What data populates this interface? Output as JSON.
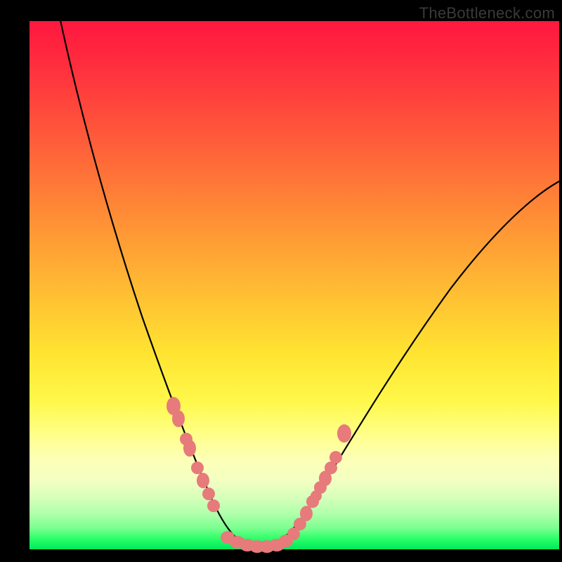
{
  "watermark": "TheBottleneck.com",
  "colors": {
    "background": "#000000",
    "gradient_top": "#ff173f",
    "gradient_bottom": "#00e85a",
    "curve": "#000000",
    "markers": "#e77a7b"
  },
  "chart_data": {
    "type": "line",
    "title": "",
    "xlabel": "",
    "ylabel": "",
    "ylim": [
      0,
      100
    ],
    "xlim": [
      0,
      100
    ],
    "series": [
      {
        "name": "bottleneck-curve",
        "x": [
          6,
          10,
          15,
          20,
          24,
          27,
          30,
          33,
          35,
          37,
          39,
          41,
          43,
          45,
          50,
          55,
          60,
          65,
          70,
          75,
          80,
          85,
          90,
          95,
          100
        ],
        "y": [
          100,
          81,
          62,
          47,
          36,
          29,
          22,
          15,
          10,
          6,
          3,
          1,
          0,
          0,
          3,
          9,
          17,
          25,
          33,
          41,
          48,
          55,
          61,
          66,
          69
        ]
      }
    ],
    "markers": {
      "left_cluster_x": [
        27.5,
        28.5,
        30.0,
        30.5,
        32.0,
        33.0,
        34.0,
        35.0
      ],
      "left_cluster_y": [
        27.0,
        25.0,
        21.0,
        20.0,
        16.0,
        13.5,
        11.0,
        9.0
      ],
      "bottom_cluster_x": [
        37.5,
        39.0,
        40.5,
        42.0,
        43.5,
        45.0,
        46.5,
        48.0
      ],
      "bottom_cluster_y": [
        1.5,
        1.0,
        0.5,
        0.3,
        0.3,
        0.5,
        1.0,
        2.0
      ],
      "right_cluster_x": [
        49.5,
        51.0,
        52.5,
        53.0,
        54.0,
        55.0,
        56.0,
        57.0,
        58.5
      ],
      "right_cluster_y": [
        4.0,
        6.0,
        8.5,
        9.5,
        11.0,
        13.0,
        15.0,
        17.5,
        22.5
      ]
    }
  }
}
